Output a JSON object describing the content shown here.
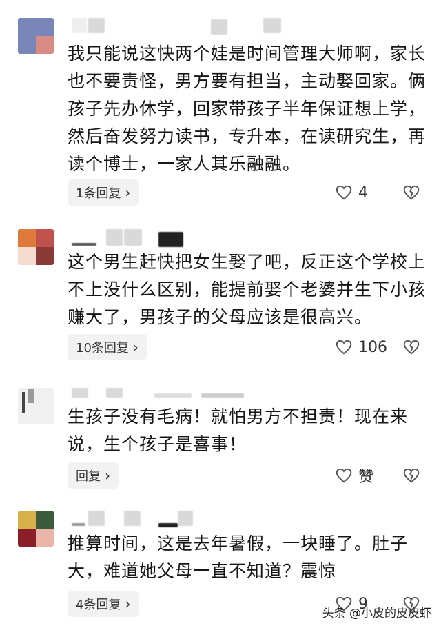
{
  "comments": [
    {
      "text": "我只能说这快两个娃是时间管理大师啊，家长也不要责怪，男方要有担当，主动娶回家。俩孩子先办休学，回家带孩子半年保证想上学，然后奋发努力读书，专升本，在读研究生，再读个博士，一家人其乐融融。",
      "replies_label": "1条回复",
      "likes": "4"
    },
    {
      "text": "这个男生赶快把女生娶了吧，反正这个学校上不上没什么区别，能提前娶个老婆并生下小孩赚大了，男孩子的父母应该是很高兴。",
      "replies_label": "10条回复",
      "likes": "106"
    },
    {
      "text": "生孩子没有毛病！就怕男方不担责！现在来说，生个孩子是喜事！",
      "replies_label": "回复",
      "likes": "赞"
    },
    {
      "text": "推算时间，这是去年暑假，一块睡了。肚子大，难道她父母一直不知道？震惊",
      "replies_label": "4条回复",
      "likes": "9"
    }
  ],
  "watermark": "头条 @小皮的皮皮虾",
  "colors": {
    "background": "#ffffff",
    "button_bg": "#f2f2f2",
    "text": "#161616"
  },
  "icons": {
    "like": "heart-outline-icon",
    "dislike": "broken-heart-icon",
    "reply": "chevron-right-icon"
  }
}
